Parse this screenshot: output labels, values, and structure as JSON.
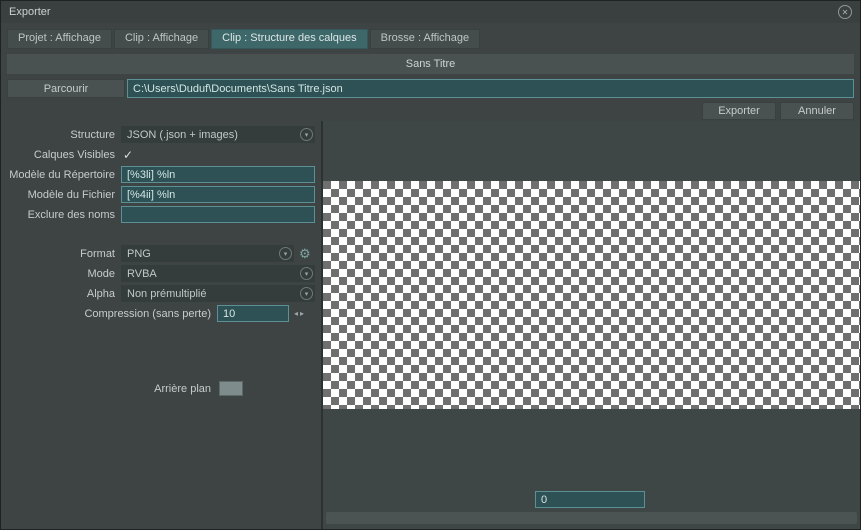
{
  "window": {
    "title": "Exporter"
  },
  "icons": {
    "close": "✕",
    "chevron": "▾",
    "gear": "⚙",
    "check": "✓",
    "spin_left": "◂",
    "spin_right": "▸"
  },
  "tabs": [
    {
      "label": "Projet : Affichage",
      "active": false
    },
    {
      "label": "Clip : Affichage",
      "active": false
    },
    {
      "label": "Clip : Structure des calques",
      "active": true
    },
    {
      "label": "Brosse : Affichage",
      "active": false
    }
  ],
  "document_title": "Sans Titre",
  "path_row": {
    "browse_label": "Parcourir",
    "path_value": "C:\\Users\\Duduf\\Documents\\Sans Titre.json"
  },
  "actions": {
    "export_label": "Exporter",
    "cancel_label": "Annuler"
  },
  "form": {
    "structure": {
      "label": "Structure",
      "value": "JSON (.json + images)"
    },
    "visible_layers": {
      "label": "Calques Visibles",
      "checked": true
    },
    "dir_template": {
      "label": "Modèle du Répertoire",
      "value": "[%3li] %ln"
    },
    "file_template": {
      "label": "Modèle du Fichier",
      "value": "[%4ii] %ln"
    },
    "exclude_names": {
      "label": "Exclure des noms",
      "value": ""
    },
    "format": {
      "label": "Format",
      "value": "PNG"
    },
    "mode": {
      "label": "Mode",
      "value": "RVBA"
    },
    "alpha": {
      "label": "Alpha",
      "value": "Non prémultiplié"
    },
    "compression": {
      "label": "Compression (sans perte)",
      "value": "10"
    },
    "background": {
      "label": "Arrière plan"
    }
  },
  "preview": {
    "frame_value": "0"
  },
  "colors": {
    "window_background": "#3e4444",
    "active_tab": "#3e6769",
    "field_background": "#2d5154",
    "field_border": "#5c9094",
    "button_background": "#4a5151",
    "checker_light": "#ffffff",
    "checker_dark": "#6f6f6f"
  }
}
